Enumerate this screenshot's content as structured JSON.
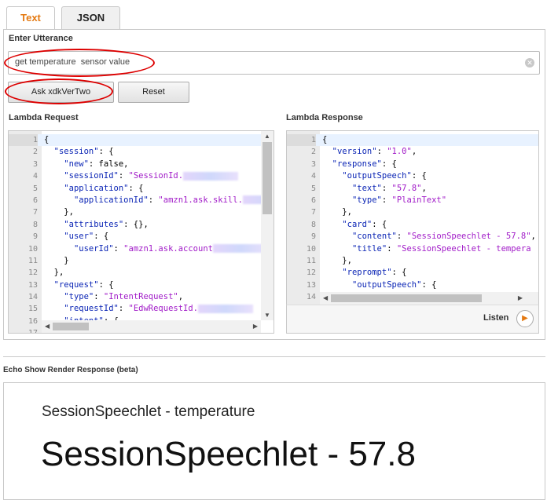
{
  "tabs": [
    {
      "label": "Text"
    },
    {
      "label": "JSON"
    }
  ],
  "utterance": {
    "label": "Enter Utterance",
    "value": "get temperature  sensor value"
  },
  "buttons": {
    "ask": "Ask xdkVerTwo",
    "reset": "Reset"
  },
  "lambda_request": {
    "label": "Lambda Request",
    "lines": [
      [
        [
          "p",
          "{"
        ]
      ],
      [
        [
          "p",
          "  "
        ],
        [
          "k",
          "\"session\""
        ],
        [
          "p",
          ": {"
        ]
      ],
      [
        [
          "p",
          "    "
        ],
        [
          "k",
          "\"new\""
        ],
        [
          "p",
          ": false,"
        ]
      ],
      [
        [
          "p",
          "    "
        ],
        [
          "k",
          "\"sessionId\""
        ],
        [
          "p",
          ": "
        ],
        [
          "s",
          "\"SessionId."
        ],
        [
          "b",
          ""
        ]
      ],
      [
        [
          "p",
          "    "
        ],
        [
          "k",
          "\"application\""
        ],
        [
          "p",
          ": {"
        ]
      ],
      [
        [
          "p",
          "      "
        ],
        [
          "k",
          "\"applicationId\""
        ],
        [
          "p",
          ": "
        ],
        [
          "s",
          "\"amzn1.ask.skill."
        ],
        [
          "b",
          ""
        ]
      ],
      [
        [
          "p",
          "    },"
        ]
      ],
      [
        [
          "p",
          "    "
        ],
        [
          "k",
          "\"attributes\""
        ],
        [
          "p",
          ": {},"
        ]
      ],
      [
        [
          "p",
          "    "
        ],
        [
          "k",
          "\"user\""
        ],
        [
          "p",
          ": {"
        ]
      ],
      [
        [
          "p",
          "      "
        ],
        [
          "k",
          "\"userId\""
        ],
        [
          "p",
          ": "
        ],
        [
          "s",
          "\"amzn1.ask.account"
        ],
        [
          "b",
          ""
        ]
      ],
      [
        [
          "p",
          "    }"
        ]
      ],
      [
        [
          "p",
          "  },"
        ]
      ],
      [
        [
          "p",
          "  "
        ],
        [
          "k",
          "\"request\""
        ],
        [
          "p",
          ": {"
        ]
      ],
      [
        [
          "p",
          "    "
        ],
        [
          "k",
          "\"type\""
        ],
        [
          "p",
          ": "
        ],
        [
          "s",
          "\"IntentRequest\""
        ],
        [
          "p",
          ","
        ]
      ],
      [
        [
          "p",
          "    "
        ],
        [
          "k",
          "\"requestId\""
        ],
        [
          "p",
          ": "
        ],
        [
          "s",
          "\"EdwRequestId."
        ],
        [
          "b",
          ""
        ]
      ],
      [
        [
          "p",
          "    "
        ],
        [
          "k",
          "\"intent\""
        ],
        [
          "p",
          ": {"
        ]
      ],
      [
        [
          "p",
          ""
        ]
      ]
    ]
  },
  "lambda_response": {
    "label": "Lambda Response",
    "lines": [
      [
        [
          "p",
          "{"
        ]
      ],
      [
        [
          "p",
          "  "
        ],
        [
          "k",
          "\"version\""
        ],
        [
          "p",
          ": "
        ],
        [
          "s",
          "\"1.0\""
        ],
        [
          "p",
          ","
        ]
      ],
      [
        [
          "p",
          "  "
        ],
        [
          "k",
          "\"response\""
        ],
        [
          "p",
          ": {"
        ]
      ],
      [
        [
          "p",
          "    "
        ],
        [
          "k",
          "\"outputSpeech\""
        ],
        [
          "p",
          ": {"
        ]
      ],
      [
        [
          "p",
          "      "
        ],
        [
          "k",
          "\"text\""
        ],
        [
          "p",
          ": "
        ],
        [
          "s",
          "\"57.8\""
        ],
        [
          "p",
          ","
        ]
      ],
      [
        [
          "p",
          "      "
        ],
        [
          "k",
          "\"type\""
        ],
        [
          "p",
          ": "
        ],
        [
          "s",
          "\"PlainText\""
        ]
      ],
      [
        [
          "p",
          "    },"
        ]
      ],
      [
        [
          "p",
          "    "
        ],
        [
          "k",
          "\"card\""
        ],
        [
          "p",
          ": {"
        ]
      ],
      [
        [
          "p",
          "      "
        ],
        [
          "k",
          "\"content\""
        ],
        [
          "p",
          ": "
        ],
        [
          "s",
          "\"SessionSpeechlet - 57.8\""
        ],
        [
          "p",
          ","
        ]
      ],
      [
        [
          "p",
          "      "
        ],
        [
          "k",
          "\"title\""
        ],
        [
          "p",
          ": "
        ],
        [
          "s",
          "\"SessionSpeechlet - tempera"
        ]
      ],
      [
        [
          "p",
          "    },"
        ]
      ],
      [
        [
          "p",
          "    "
        ],
        [
          "k",
          "\"reprompt\""
        ],
        [
          "p",
          ": {"
        ]
      ],
      [
        [
          "p",
          "      "
        ],
        [
          "k",
          "\"outputSpeech\""
        ],
        [
          "p",
          ": {"
        ]
      ],
      [
        [
          "p",
          ""
        ]
      ],
      [
        [
          "p",
          ""
        ]
      ]
    ]
  },
  "listen": {
    "label": "Listen"
  },
  "echo": {
    "label": "Echo Show Render Response (beta)",
    "title": "SessionSpeechlet - temperature",
    "text": "SessionSpeechlet - 57.8"
  },
  "colors": {
    "accent": "#e47911",
    "key": "#0b25b5",
    "string": "#a11bc8",
    "annotation": "#dd0000"
  },
  "icons": {
    "clear": "clear-icon",
    "play": "play-icon",
    "scroll_up": "scroll-up-icon",
    "scroll_down": "scroll-down-icon",
    "scroll_left": "scroll-left-icon",
    "scroll_right": "scroll-right-icon"
  }
}
